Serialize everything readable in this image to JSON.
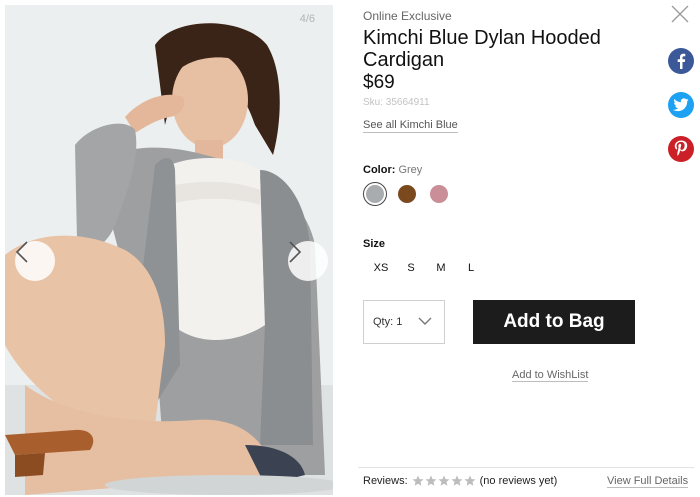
{
  "gallery": {
    "counter": "4/6"
  },
  "product": {
    "kicker": "Online Exclusive",
    "title": "Kimchi Blue Dylan Hooded Cardigan",
    "price": "$69",
    "sku": "Sku: 35664911",
    "see_all": "See all Kimchi Blue"
  },
  "color": {
    "label": "Color:",
    "selected": "Grey",
    "swatches": [
      {
        "name": "Grey",
        "hex": "#a9acae"
      },
      {
        "name": "Brown",
        "hex": "#7a4a1e"
      },
      {
        "name": "Mauve",
        "hex": "#c98e98"
      }
    ]
  },
  "size": {
    "label": "Size",
    "options": [
      "XS",
      "S",
      "M",
      "L"
    ]
  },
  "qty": {
    "label": "Qty: 1"
  },
  "actions": {
    "add_to_bag": "Add to Bag",
    "wishlist": "Add to WishList"
  },
  "social": {
    "facebook": "#3b5998",
    "twitter": "#1da1f2",
    "pinterest": "#cb2027"
  },
  "reviews": {
    "label": "Reviews:",
    "status": "(no reviews yet)",
    "rating": 0,
    "max": 5,
    "view_full": "View Full Details"
  }
}
